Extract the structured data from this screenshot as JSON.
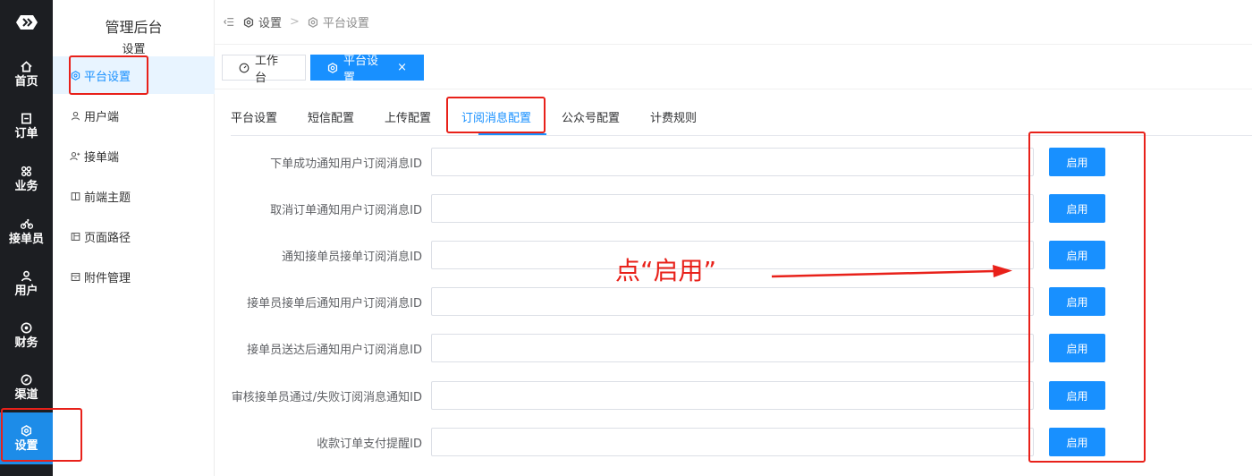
{
  "rail": {
    "items": [
      {
        "label": "首页",
        "icon": "home-icon"
      },
      {
        "label": "订单",
        "icon": "order-icon"
      },
      {
        "label": "业务",
        "icon": "command-icon"
      },
      {
        "label": "接单员",
        "icon": "bicycle-icon"
      },
      {
        "label": "用户",
        "icon": "user-icon"
      },
      {
        "label": "财务",
        "icon": "finance-icon"
      },
      {
        "label": "渠道",
        "icon": "compass-icon"
      },
      {
        "label": "设置",
        "icon": "gear-icon"
      }
    ],
    "active_index": 7,
    "active_color": "#1d8ce8"
  },
  "submenu": {
    "app_title": "管理后台",
    "section_title": "设置",
    "items": [
      {
        "label": "平台设置",
        "icon": "gear-icon"
      },
      {
        "label": "用户端",
        "icon": "user-icon"
      },
      {
        "label": "接单端",
        "icon": "user-plus-icon"
      },
      {
        "label": "前端主题",
        "icon": "book-icon"
      },
      {
        "label": "页面路径",
        "icon": "layout-icon"
      },
      {
        "label": "附件管理",
        "icon": "archive-icon"
      }
    ],
    "active_index": 0
  },
  "breadcrumb": {
    "items": [
      {
        "label": "设置",
        "icon": "gear-icon"
      },
      {
        "label": "平台设置",
        "icon": "gear-icon"
      }
    ],
    "separator": ">"
  },
  "tags": {
    "items": [
      {
        "label": "工作台",
        "icon": "dashboard-icon"
      },
      {
        "label": "平台设置",
        "icon": "gear-icon",
        "close": "×"
      }
    ],
    "active_index": 1
  },
  "tabs": {
    "items": [
      "平台设置",
      "短信配置",
      "上传配置",
      "订阅消息配置",
      "公众号配置",
      "计费规则"
    ],
    "active_index": 3
  },
  "form": {
    "rows": [
      {
        "label": "下单成功通知用户订阅消息ID",
        "value": "",
        "button": "启用"
      },
      {
        "label": "取消订单通知用户订阅消息ID",
        "value": "",
        "button": "启用"
      },
      {
        "label": "通知接单员接单订阅消息ID",
        "value": "",
        "button": "启用"
      },
      {
        "label": "接单员接单后通知用户订阅消息ID",
        "value": "",
        "button": "启用"
      },
      {
        "label": "接单员送达后通知用户订阅消息ID",
        "value": "",
        "button": "启用"
      },
      {
        "label": "审核接单员通过/失败订阅消息通知ID",
        "value": "",
        "button": "启用"
      },
      {
        "label": "收款订单支付提醒ID",
        "value": "",
        "button": "启用"
      }
    ]
  },
  "annotation": {
    "text": "点“启用”",
    "color": "#e8211a"
  },
  "colors": {
    "primary": "#1890ff",
    "rail_bg": "#1c1e22"
  }
}
